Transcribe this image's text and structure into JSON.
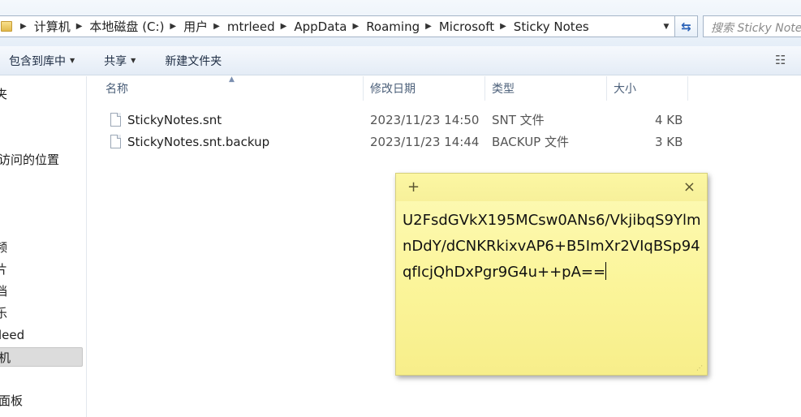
{
  "address": {
    "crumbs": [
      "计算机",
      "本地磁盘 (C:)",
      "用户",
      "mtrleed",
      "AppData",
      "Roaming",
      "Microsoft",
      "Sticky Notes"
    ],
    "search_placeholder": "搜索 Sticky Notes"
  },
  "toolbar": {
    "include_library": "包含到库中",
    "share": "共享",
    "new_folder": "新建文件夹"
  },
  "nav": {
    "items": [
      "夹",
      "访问的位置",
      "频",
      "片",
      "档",
      "乐",
      "leed",
      "机",
      "面板"
    ]
  },
  "columns": {
    "name": "名称",
    "modified": "修改日期",
    "type": "类型",
    "size": "大小"
  },
  "files": [
    {
      "name": "StickyNotes.snt",
      "modified": "2023/11/23 14:50",
      "type": "SNT 文件",
      "size": "4 KB"
    },
    {
      "name": "StickyNotes.snt.backup",
      "modified": "2023/11/23 14:44",
      "type": "BACKUP 文件",
      "size": "3 KB"
    }
  ],
  "sticky": {
    "add_label": "+",
    "close_label": "×",
    "text": "U2FsdGVkX195MCsw0ANs6/VkjibqS9YlmnDdY/dCNKRkixvAP6+B5ImXr2VIqBSp94qfIcjQhDxPgr9G4u++pA=="
  },
  "colors": {
    "sticky_bg": "#fbf59a",
    "crumb_sep": "#333333"
  }
}
